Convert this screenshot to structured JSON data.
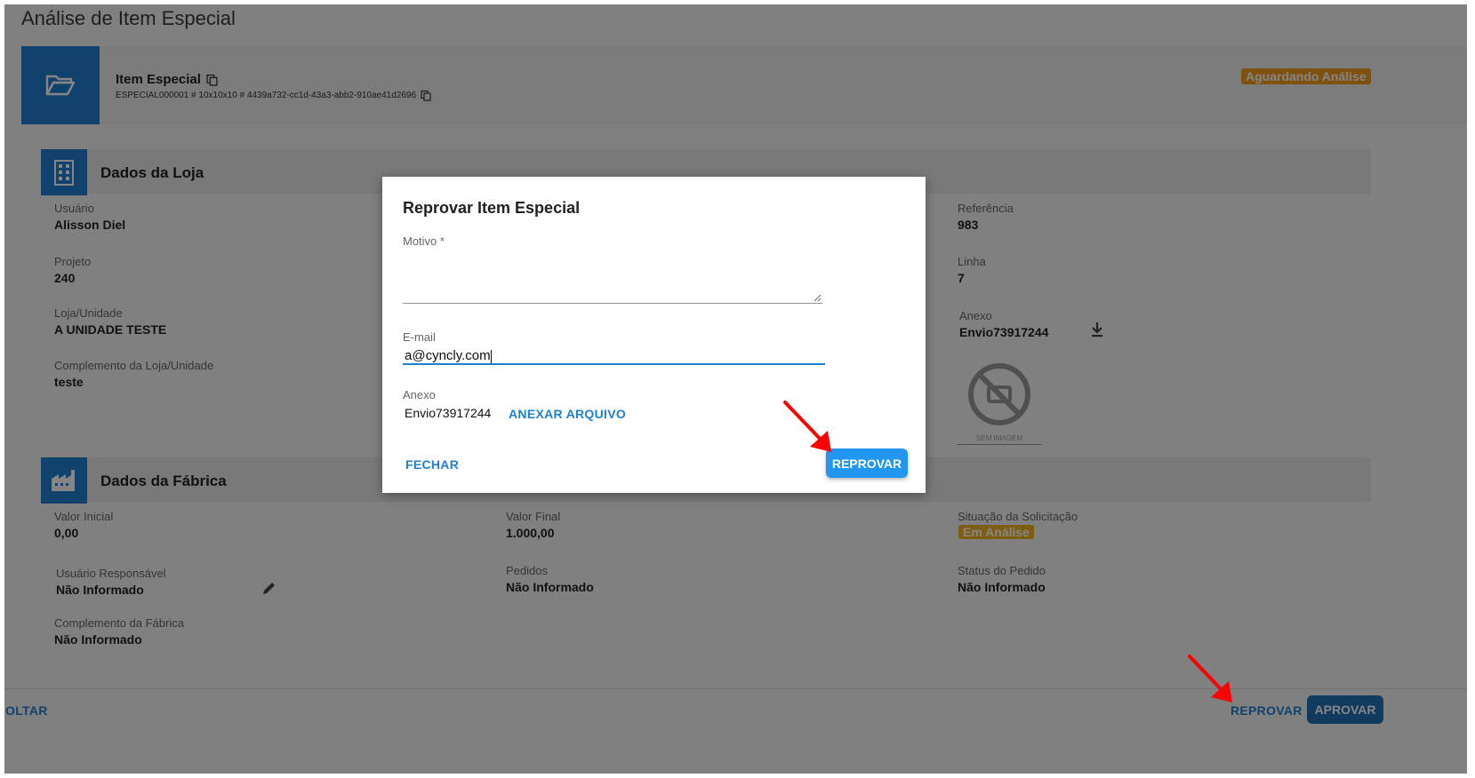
{
  "page": {
    "title": "Análise de Item Especial"
  },
  "item": {
    "title": "Item Especial",
    "code": "ESPECIAL000001 # 10x10x10 # 4439a732-cc1d-43a3-abb2-910ae41d2696",
    "status": "Aguardando Análise"
  },
  "loja": {
    "section_title": "Dados da Loja",
    "usuario_label": "Usuário",
    "usuario_value": "Alisson Diel",
    "projeto_label": "Projeto",
    "projeto_value": "240",
    "loja_label": "Loja/Unidade",
    "loja_value": "A UNIDADE TESTE",
    "complemento_label": "Complemento da Loja/Unidade",
    "complemento_value": "teste",
    "referencia_label": "Referência",
    "referencia_value": "983",
    "linha_label": "Linha",
    "linha_value": "7",
    "anexo_label": "Anexo",
    "anexo_value": "Envio73917244",
    "sem_imagem": "SEM IMAGEM"
  },
  "fabrica": {
    "section_title": "Dados da Fábrica",
    "valor_inicial_label": "Valor Inicial",
    "valor_inicial_value": "0,00",
    "valor_final_label": "Valor Final",
    "valor_final_value": "1.000,00",
    "situacao_label": "Situação da Solicitação",
    "situacao_value": "Em Análise",
    "usuario_resp_label": "Usuário Responsável",
    "usuario_resp_value": "Não Informado",
    "pedidos_label": "Pedidos",
    "pedidos_value": "Não Informado",
    "status_pedido_label": "Status do Pedido",
    "status_pedido_value": "Não Informado",
    "complemento_label": "Complemento da Fábrica",
    "complemento_value": "Não Informado"
  },
  "footer": {
    "voltar": "OLTAR",
    "reprovar": "REPROVAR",
    "aprovar": "APROVAR"
  },
  "modal": {
    "title": "Reprovar Item Especial",
    "motivo_label": "Motivo *",
    "motivo_value": "",
    "email_label": "E-mail",
    "email_value": "a@cyncly.com",
    "anexo_label": "Anexo",
    "anexo_value": "Envio73917244",
    "anexar_button": "ANEXAR ARQUIVO",
    "fechar_button": "FECHAR",
    "reprovar_button": "REPROVAR"
  },
  "colors": {
    "primary": "#1f7fd1",
    "status_orange": "#f29b1d",
    "status_yellow": "#f2b31d",
    "annotation_arrow": "#ff0000"
  }
}
